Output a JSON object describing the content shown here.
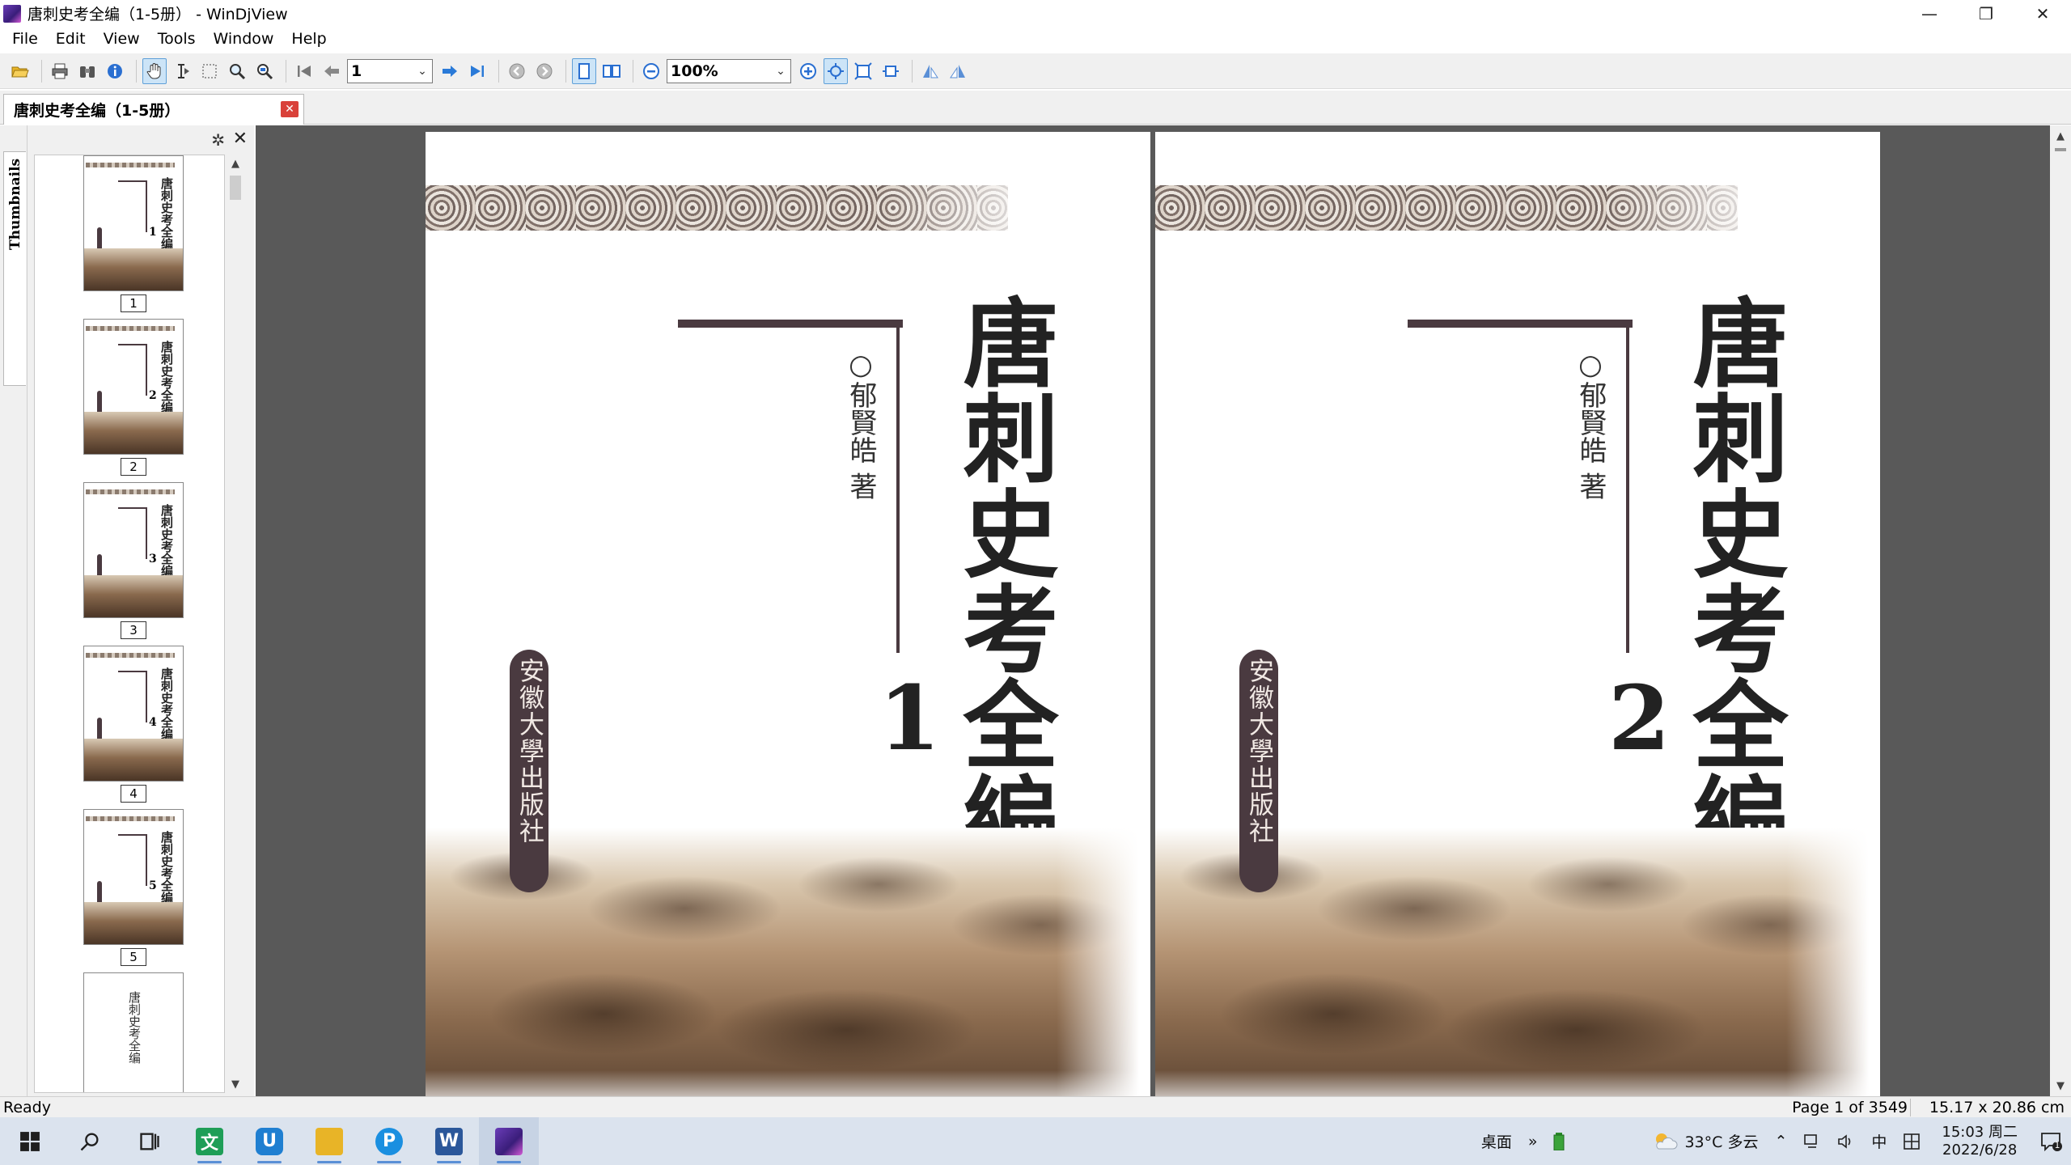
{
  "window": {
    "title": "唐刺史考全编（1-5册） - WinDjView",
    "controls": {
      "minimize": "—",
      "maximize": "❐",
      "close": "✕"
    }
  },
  "menu": [
    "File",
    "Edit",
    "View",
    "Tools",
    "Window",
    "Help"
  ],
  "toolbar": {
    "page_input": "1",
    "zoom_value": "100%"
  },
  "tab": {
    "label": "唐刺史考全编（1-5册）",
    "close": "✕"
  },
  "sidebar": {
    "tab_label": "Thumbnails",
    "gear": "✲",
    "close": "✕",
    "thumbnails": [
      {
        "label": "1",
        "title": "唐刺史考全编",
        "num": "1"
      },
      {
        "label": "2",
        "title": "唐刺史考全编",
        "num": "2"
      },
      {
        "label": "3",
        "title": "唐刺史考全编",
        "num": "3"
      },
      {
        "label": "4",
        "title": "唐刺史考全编",
        "num": "4"
      },
      {
        "label": "5",
        "title": "唐刺史考全编",
        "num": "5"
      },
      {
        "label": "",
        "title": "唐刺史考全编",
        "num": ""
      }
    ]
  },
  "pages": [
    {
      "title": "唐刺史考全編",
      "author": "○郁賢皓 著",
      "volume": "1",
      "publisher": "安徽大學出版社"
    },
    {
      "title": "唐刺史考全編",
      "author": "○郁賢皓 著",
      "volume": "2",
      "publisher": "安徽大學出版社"
    }
  ],
  "status": {
    "left": "Ready",
    "page": "Page 1 of 3549",
    "size": "15.17 x 20.86 cm"
  },
  "taskbar": {
    "apps": [
      {
        "name": "start",
        "glyph": "⊞",
        "color": "#1f1f1f"
      },
      {
        "name": "search",
        "glyph": "⚲",
        "color": "#1f1f1f"
      },
      {
        "name": "task-view",
        "glyph": "⧉",
        "color": "#1f1f1f"
      },
      {
        "name": "wps-text",
        "glyph": "文",
        "color": "#1e9e57"
      },
      {
        "name": "shield",
        "glyph": "U",
        "color": "#1f7fd1"
      },
      {
        "name": "file-explorer",
        "glyph": "▆",
        "color": "#e8b427"
      },
      {
        "name": "p-app",
        "glyph": "P",
        "color": "#1a8fe0"
      },
      {
        "name": "word",
        "glyph": "W",
        "color": "#2b579a"
      },
      {
        "name": "windjview",
        "glyph": "▧",
        "color": "#6a3db8"
      }
    ],
    "desktop_label": "桌面",
    "chevron": "»",
    "weather": "33°C 多云",
    "ime": "中",
    "time": "15:03 周二",
    "date": "2022/6/28",
    "notif_count": "1"
  }
}
